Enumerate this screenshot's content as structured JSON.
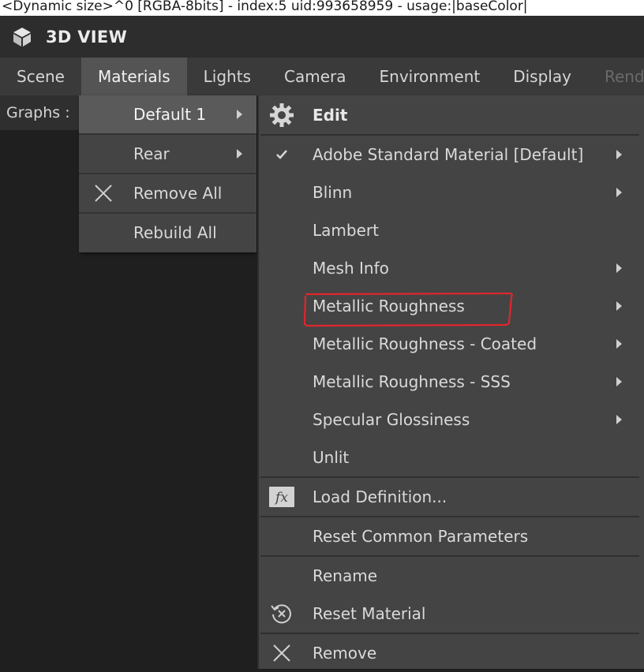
{
  "info_bar": {
    "text": "<Dynamic size>^0 [RGBA-8bits] - index:5 uid:993658959 - usage:|baseColor|"
  },
  "title_bar": {
    "icon": "cube-icon",
    "title": "3D VIEW"
  },
  "menu_bar": {
    "items": [
      {
        "label": "Scene"
      },
      {
        "label": "Materials",
        "active": true
      },
      {
        "label": "Lights"
      },
      {
        "label": "Camera"
      },
      {
        "label": "Environment"
      },
      {
        "label": "Display"
      },
      {
        "label": "Rendere"
      }
    ]
  },
  "graphs": {
    "label": "Graphs :"
  },
  "submenu": {
    "items": [
      {
        "label": "Default 1",
        "has_submenu": true,
        "highlighted": true
      },
      {
        "label": "Rear",
        "has_submenu": true
      },
      {
        "label": "Remove All",
        "icon": "close-icon"
      },
      {
        "label": "Rebuild All"
      }
    ]
  },
  "material_menu": {
    "edit": {
      "label": "Edit",
      "icon": "gear-icon"
    },
    "shaders": [
      {
        "label": "Adobe Standard Material [Default]",
        "checked": true,
        "has_submenu": true
      },
      {
        "label": "Blinn",
        "has_submenu": true
      },
      {
        "label": "Lambert",
        "has_submenu": false
      },
      {
        "label": "Mesh Info",
        "has_submenu": true
      },
      {
        "label": "Metallic Roughness",
        "has_submenu": true,
        "annotated": true
      },
      {
        "label": "Metallic Roughness - Coated",
        "has_submenu": true
      },
      {
        "label": "Metallic Roughness - SSS",
        "has_submenu": true
      },
      {
        "label": "Specular Glossiness",
        "has_submenu": true
      },
      {
        "label": "Unlit",
        "has_submenu": false
      }
    ],
    "load_definition": {
      "label": "Load Definition...",
      "icon": "fx-icon"
    },
    "reset_common": {
      "label": "Reset Common Parameters"
    },
    "rename": {
      "label": "Rename"
    },
    "reset_material": {
      "label": "Reset Material",
      "icon": "reset-icon"
    },
    "remove": {
      "label": "Remove",
      "icon": "close-icon"
    }
  },
  "colors": {
    "menu_bg": "#444444",
    "highlight_bg": "#5a5a5a",
    "annotation": "#e0262d"
  }
}
